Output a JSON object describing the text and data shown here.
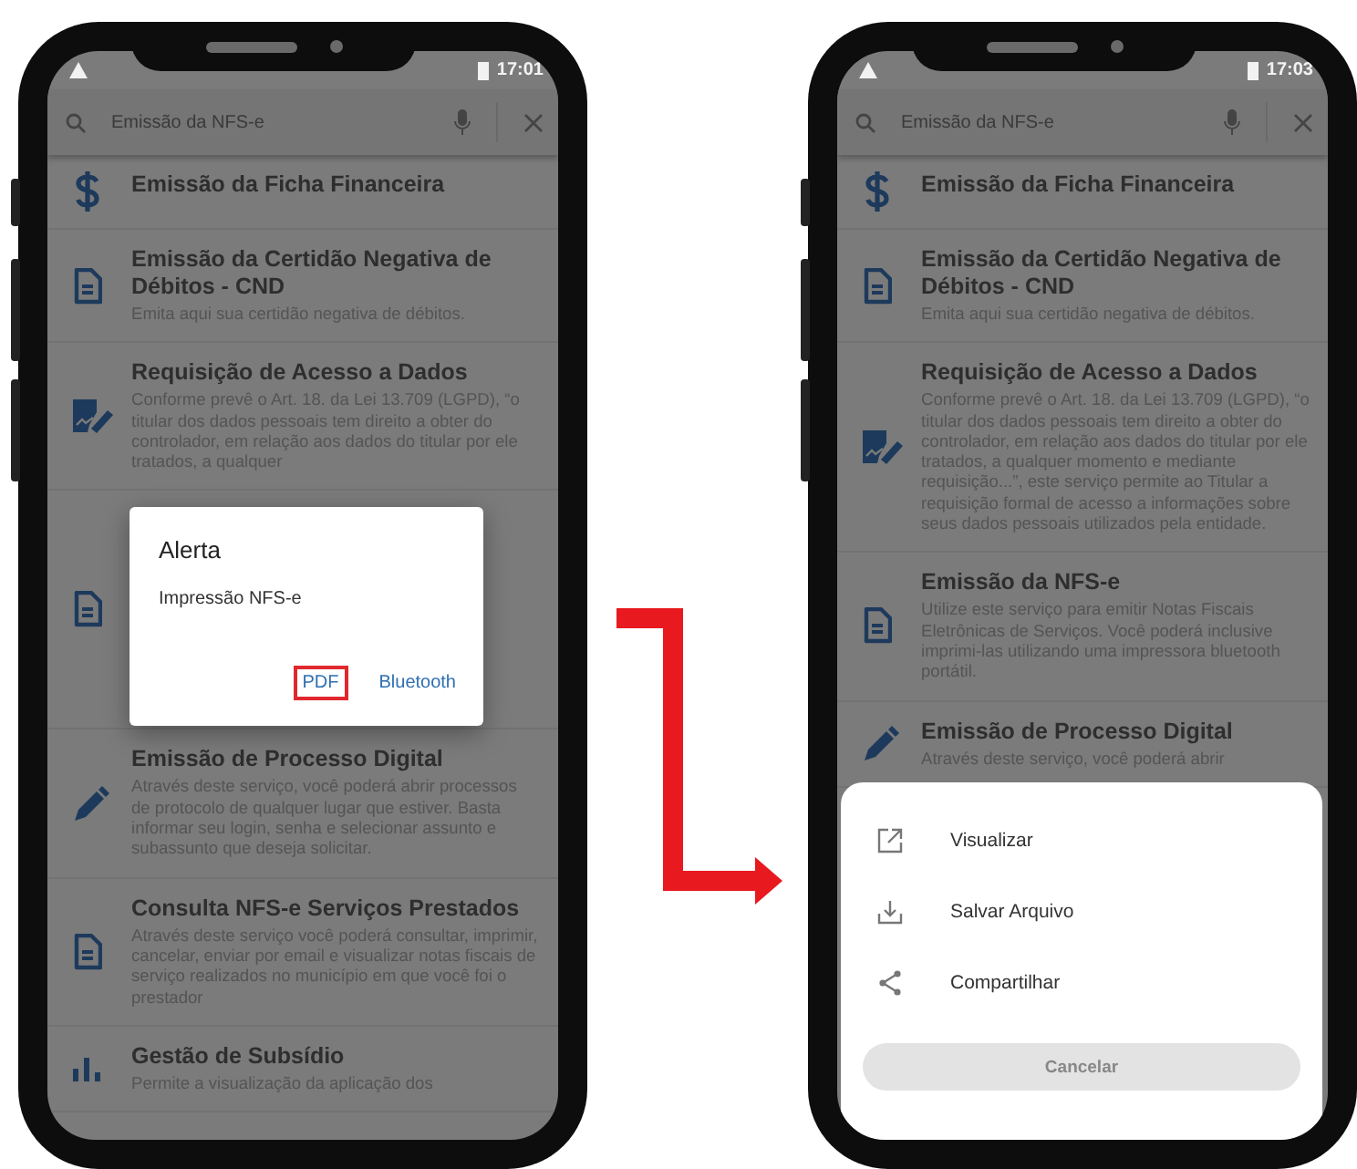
{
  "phones": [
    {
      "status_bar": {
        "time": "17:01"
      },
      "search": {
        "value": "Emissão da NFS-e"
      },
      "items": [
        {
          "kind": "dollar",
          "title": "Emissão da Ficha Financeira"
        },
        {
          "kind": "document",
          "title": "Emissão da Certidão Negativa de Débitos - CND",
          "description": "Emita aqui sua certidão negativa de débitos."
        },
        {
          "kind": "signature",
          "title": "Requisição de Acesso a Dados",
          "description": "Conforme prevê o Art. 18. da Lei 13.709 (LGPD), “o titular dos dados pessoais tem direito a obter do controlador, em relação aos dados do titular por ele tratados, a qualquer"
        },
        {
          "kind": "document"
        },
        {
          "kind": "pen",
          "title": "Emissão de Processo Digital",
          "description": "Através deste serviço, você poderá abrir processos de protocolo de qualquer lugar que estiver. Basta informar seu login, senha e selecionar assunto e subassunto que deseja solicitar."
        },
        {
          "kind": "document",
          "title": "Consulta NFS-e Serviços Prestados",
          "description": "Através deste serviço você poderá consultar, imprimir, cancelar, enviar por email e visualizar notas fiscais de serviço realizados no município em que você foi o prestador"
        },
        {
          "kind": "chart",
          "title": "Gestão de Subsídio",
          "description": "Permite a visualização da aplicação dos"
        }
      ],
      "dialog": {
        "title": "Alerta",
        "message": "Impressão NFS-e",
        "buttons": [
          {
            "label": "PDF",
            "highlighted": true
          },
          {
            "label": "Bluetooth",
            "highlighted": false
          }
        ]
      }
    },
    {
      "status_bar": {
        "time": "17:03"
      },
      "search": {
        "value": "Emissão da NFS-e"
      },
      "items": [
        {
          "kind": "dollar",
          "title": "Emissão da Ficha Financeira"
        },
        {
          "kind": "document",
          "title": "Emissão da Certidão Negativa de Débitos - CND",
          "description": "Emita aqui sua certidão negativa de débitos."
        },
        {
          "kind": "signature",
          "title": "Requisição de Acesso a Dados",
          "description": "Conforme prevê o Art. 18. da Lei 13.709 (LGPD), “o titular dos dados pessoais tem direito a obter do controlador, em relação aos dados do titular por ele tratados, a qualquer momento e mediante requisição...”, este serviço permite ao Titular a requisição formal de acesso a informações sobre seus dados pessoais utilizados pela entidade."
        },
        {
          "kind": "document",
          "title": "Emissão da NFS-e",
          "description": "Utilize este serviço para emitir Notas Fiscais Eletrônicas de Serviços. Você poderá inclusive imprimi-las utilizando uma impressora bluetooth portátil."
        },
        {
          "kind": "pen",
          "title": "Emissão de Processo Digital",
          "description": "Através deste serviço, você poderá abrir"
        }
      ],
      "sheet": {
        "actions": [
          {
            "kind": "open",
            "label": "Visualizar"
          },
          {
            "kind": "download",
            "label": "Salvar Arquivo"
          },
          {
            "kind": "share",
            "label": "Compartilhar"
          }
        ],
        "cancel": "Cancelar"
      }
    }
  ]
}
